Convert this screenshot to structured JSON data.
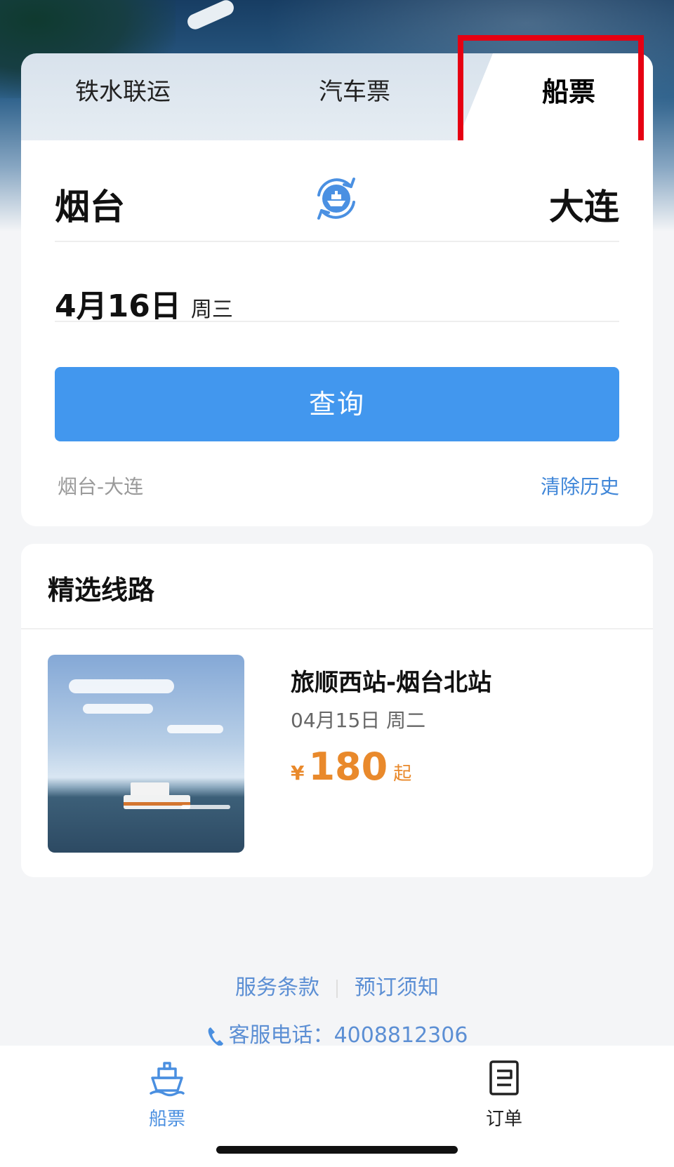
{
  "tabs": [
    {
      "label": "铁水联运",
      "active": false
    },
    {
      "label": "汽车票",
      "active": false
    },
    {
      "label": "船票",
      "active": true
    }
  ],
  "search": {
    "from_city": "烟台",
    "to_city": "大连",
    "date": "4月16日",
    "weekday": "周三",
    "button_label": "查询",
    "history_item": "烟台-大连",
    "clear_history_label": "清除历史"
  },
  "routes": {
    "title": "精选线路",
    "items": [
      {
        "name": "旅顺西站-烟台北站",
        "date": "04月15日 周二",
        "currency": "¥",
        "price": "180",
        "price_suffix": "起"
      }
    ]
  },
  "footer": {
    "terms_label": "服务条款",
    "booking_notice_label": "预订须知",
    "hotline_label": "客服电话：",
    "hotline_number": "4008812306"
  },
  "bottom_nav": [
    {
      "label": "船票",
      "icon": "ship-icon",
      "active": true
    },
    {
      "label": "订单",
      "icon": "order-icon",
      "active": false
    }
  ],
  "colors": {
    "primary": "#4297EE",
    "price": "#E9892B",
    "highlight": "#E60012",
    "link": "#5C8FD4"
  }
}
